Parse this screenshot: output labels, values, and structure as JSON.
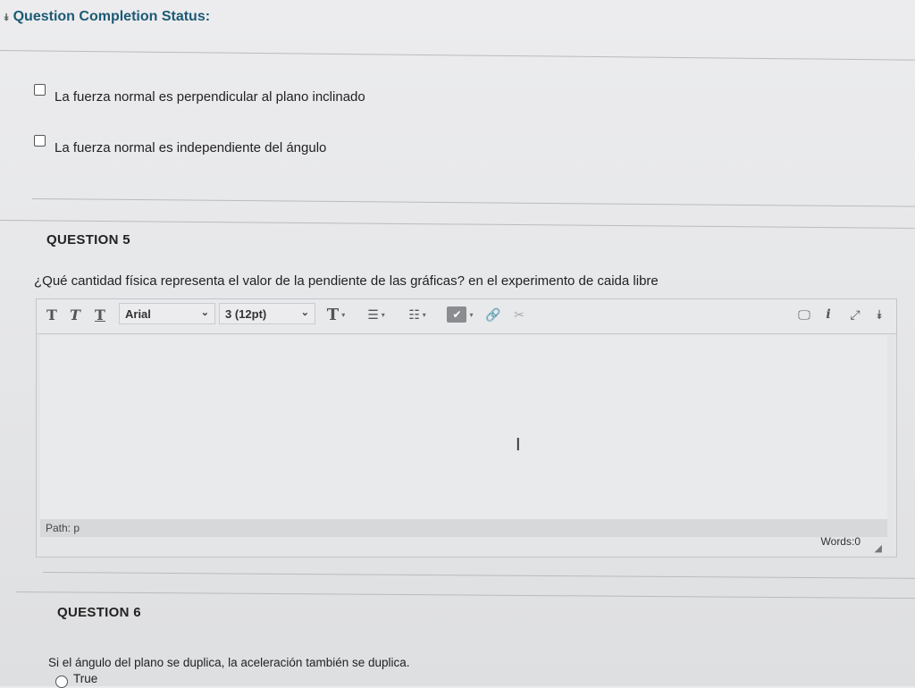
{
  "status": {
    "label": "Question Completion Status:"
  },
  "q4": {
    "choices": [
      {
        "label": "La fuerza normal es perpendicular al plano inclinado"
      },
      {
        "label": "La fuerza normal es independiente del ángulo"
      }
    ]
  },
  "q5": {
    "title": "QUESTION 5",
    "text": "¿Qué cantidad física representa el valor de la pendiente de las gráficas? en el experimento de caida libre",
    "editor": {
      "font_family": "Arial",
      "font_size": "3 (12pt)",
      "path": "Path: p",
      "words": "Words:0"
    }
  },
  "q6": {
    "title": "QUESTION 6",
    "text": "Si el ángulo del plano se duplica, la aceleración también se duplica.",
    "options": [
      {
        "label": "True"
      }
    ]
  }
}
